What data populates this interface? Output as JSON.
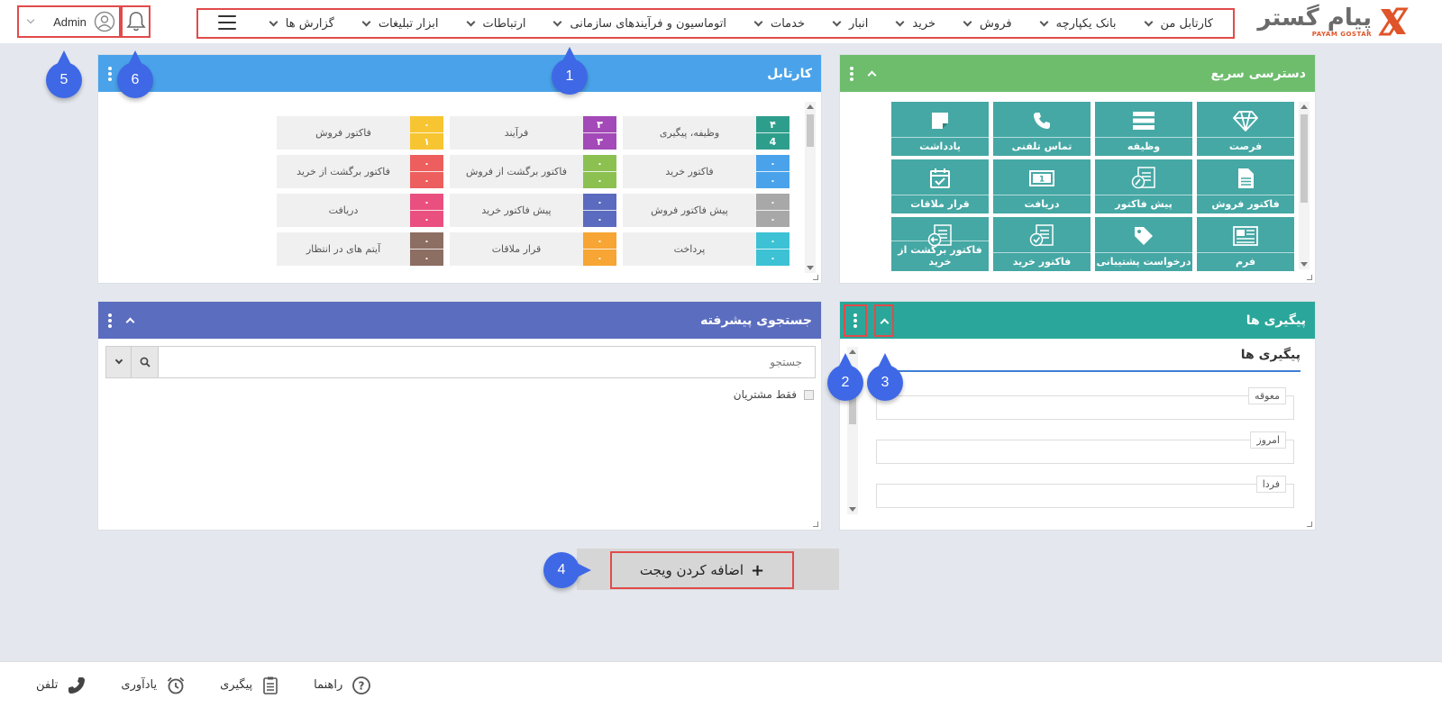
{
  "brand": {
    "name_fa": "پیام گستر",
    "name_en": "PAYAM GOSTAR",
    "accent": "#e0542a"
  },
  "nav": {
    "items": [
      {
        "label": "کارتابل من",
        "has_dropdown": true
      },
      {
        "label": "بانک یکپارچه",
        "has_dropdown": true
      },
      {
        "label": "فروش",
        "has_dropdown": true
      },
      {
        "label": "خرید",
        "has_dropdown": true
      },
      {
        "label": "انبار",
        "has_dropdown": true
      },
      {
        "label": "خدمات",
        "has_dropdown": true
      },
      {
        "label": "اتوماسیون و فرآیندهای سازمانی",
        "has_dropdown": true
      },
      {
        "label": "ارتباطات",
        "has_dropdown": true
      },
      {
        "label": "ابزار تبلیغات",
        "has_dropdown": true
      },
      {
        "label": "گزارش ها",
        "has_dropdown": true
      }
    ]
  },
  "user": {
    "name": "Admin"
  },
  "markers": [
    "1",
    "2",
    "3",
    "4",
    "5",
    "6"
  ],
  "quick_access": {
    "title": "دسترسی سریع",
    "color": "#6dbd6d",
    "tile_color": "#45a8a5",
    "tiles": [
      {
        "label": "فرصت",
        "icon": "diamond-icon"
      },
      {
        "label": "وظیفه",
        "icon": "task-list-icon"
      },
      {
        "label": "تماس تلفنی",
        "icon": "phone-icon"
      },
      {
        "label": "یادداشت",
        "icon": "note-icon"
      },
      {
        "label": "فاکتور فروش",
        "icon": "document-icon"
      },
      {
        "label": "پیش فاکتور",
        "icon": "proforma-icon"
      },
      {
        "label": "دریافت",
        "icon": "money-icon"
      },
      {
        "label": "قرار ملاقات",
        "icon": "calendar-check-icon"
      },
      {
        "label": "فرم",
        "icon": "form-icon"
      },
      {
        "label": "درخواست پشتیبانی",
        "icon": "tag-icon"
      },
      {
        "label": "فاکتور خرید",
        "icon": "purchase-invoice-icon"
      },
      {
        "label": "فاکتور برگشت از خرید",
        "icon": "return-invoice-icon"
      }
    ]
  },
  "kartable": {
    "title": "کارتابل",
    "color": "#4aa3ea",
    "items": [
      {
        "label": "وظیفه، پیگیری",
        "top": "۴",
        "bottom": "4",
        "color": "#2e9e8c"
      },
      {
        "label": "فرآیند",
        "top": "۳",
        "bottom": "۳",
        "color": "#a349b8"
      },
      {
        "label": "فاکتور فروش",
        "top": "۰",
        "bottom": "۱",
        "color": "#f7c531"
      },
      {
        "label": "فاکتور خرید",
        "top": "۰",
        "bottom": "۰",
        "color": "#4aa3ea"
      },
      {
        "label": "فاکتور برگشت از فروش",
        "top": "۰",
        "bottom": "۰",
        "color": "#8cc152"
      },
      {
        "label": "فاکتور برگشت از خرید",
        "top": "۰",
        "bottom": "۰",
        "color": "#ed5e5e"
      },
      {
        "label": "پیش فاکتور فروش",
        "top": "۰",
        "bottom": "۰",
        "color": "#a8a8a8"
      },
      {
        "label": "پیش فاکتور خرید",
        "top": "۰",
        "bottom": "۰",
        "color": "#5b6bbf"
      },
      {
        "label": "دریافت",
        "top": "۰",
        "bottom": "۰",
        "color": "#e9507f"
      },
      {
        "label": "پرداخت",
        "top": "۰",
        "bottom": "۰",
        "color": "#3cc2d4"
      },
      {
        "label": "قرار ملاقات",
        "top": "۰",
        "bottom": "۰",
        "color": "#f7a534"
      },
      {
        "label": "آیتم های در انتظار",
        "top": "۰",
        "bottom": "۰",
        "color": "#8d6e63"
      }
    ]
  },
  "followups": {
    "title": "پیگیری ها",
    "inner_title": "پیگیری ها",
    "color": "#2aa79a",
    "groups": [
      "معوقه",
      "امروز",
      "فردا"
    ]
  },
  "advanced_search": {
    "title": "جستجوی پیشرفته",
    "color": "#5b6dbf",
    "placeholder": "جستجو",
    "only_customers_label": "فقط مشتریان"
  },
  "add_widget": {
    "label": "اضافه کردن ویجت"
  },
  "footer": {
    "items": [
      {
        "label": "تلفن",
        "icon": "phone-icon"
      },
      {
        "label": "یادآوری",
        "icon": "alarm-clock-icon"
      },
      {
        "label": "پیگیری",
        "icon": "clipboard-icon"
      },
      {
        "label": "راهنما",
        "icon": "help-icon"
      }
    ]
  }
}
